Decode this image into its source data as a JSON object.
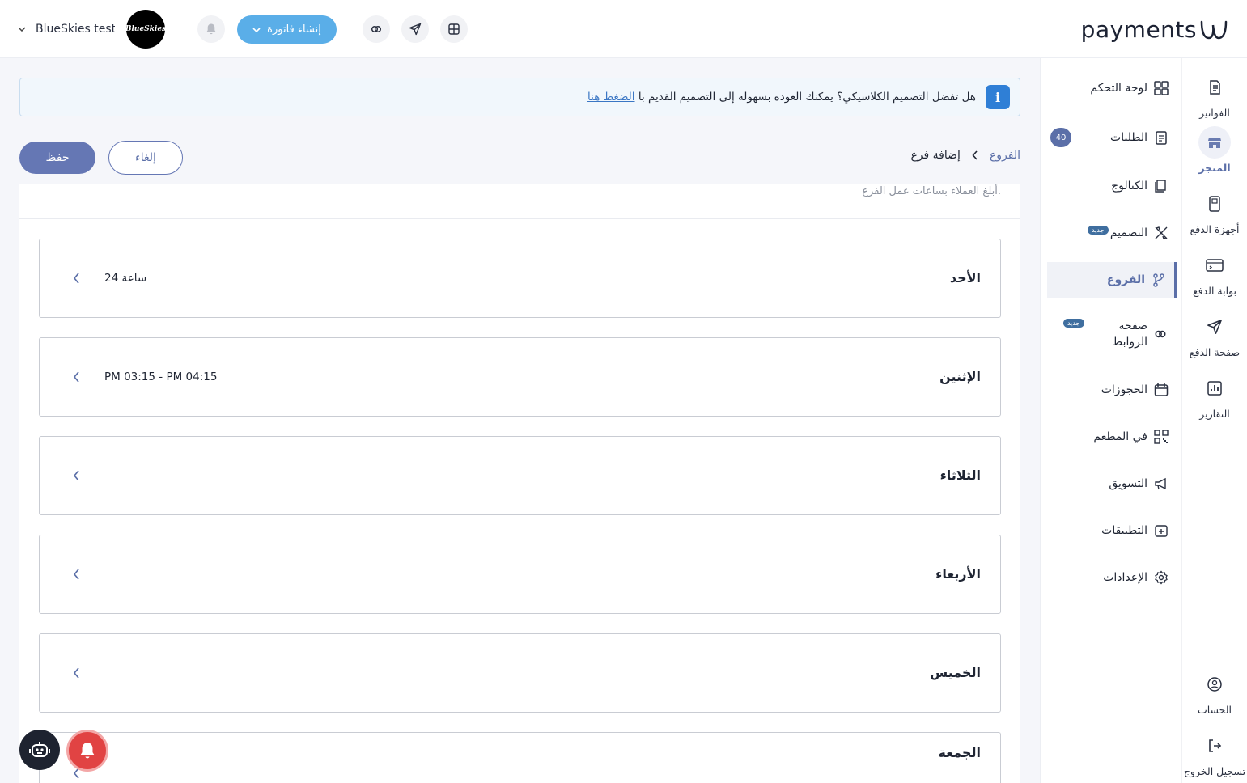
{
  "brand": {
    "name": "payments"
  },
  "header": {
    "user_name": "BlueSkies testi…",
    "avatar_text": "BlueSkies",
    "create_invoice_label": "إنشاء فاتورة"
  },
  "rail": {
    "items": [
      {
        "label": "الفواتير",
        "icon": "invoice-icon"
      },
      {
        "label": "المتجر",
        "icon": "store-icon",
        "active": true
      },
      {
        "label": "أجهزة الدفع",
        "icon": "pos-device-icon"
      },
      {
        "label": "بوابة الدفع",
        "icon": "gateway-icon"
      },
      {
        "label": "صفحة الدفع",
        "icon": "send-icon"
      },
      {
        "label": "التقارير",
        "icon": "reports-icon"
      }
    ],
    "account_label": "الحساب",
    "logout_label": "تسجيل الخروج"
  },
  "sidebar": {
    "items": [
      {
        "label": "لوحة التحكم",
        "icon": "dashboard-icon"
      },
      {
        "label": "الطلبات",
        "icon": "orders-icon",
        "badge": "40"
      },
      {
        "label": "الكتالوج",
        "icon": "catalog-icon"
      },
      {
        "label": "التصميم",
        "icon": "design-icon",
        "tag": "جديد"
      },
      {
        "label": "الفروع",
        "icon": "branches-icon",
        "active": true
      },
      {
        "label": "صفحة الروابط",
        "icon": "links-icon",
        "tag": "جديد"
      },
      {
        "label": "الحجوزات",
        "icon": "calendar-icon"
      },
      {
        "label": "في المطعم",
        "icon": "qr-icon"
      },
      {
        "label": "التسويق",
        "icon": "megaphone-icon"
      },
      {
        "label": "التطبيقات",
        "icon": "apps-icon"
      },
      {
        "label": "الإعدادات",
        "icon": "settings-icon"
      }
    ]
  },
  "banner": {
    "text": "هل تفضل التصميم الكلاسيكي؟ يمكنك العودة بسهولة إلى التصميم القديم با",
    "link": "الضغط هنا"
  },
  "breadcrumb": {
    "root": "الفروع",
    "current": "إضافة فرع"
  },
  "actions": {
    "save": "حفظ",
    "cancel": "إلغاء"
  },
  "card": {
    "subtitle": "أبلغ العملاء بساعات عمل الفرع.",
    "days": [
      {
        "name": "الأحد",
        "hours": "24 ساعة"
      },
      {
        "name": "الإثنين",
        "hours": "PM 03:15 - PM 04:15"
      },
      {
        "name": "الثلاثاء",
        "hours": ""
      },
      {
        "name": "الأربعاء",
        "hours": ""
      },
      {
        "name": "الخميس",
        "hours": ""
      },
      {
        "name": "الجمعة",
        "hours": ""
      }
    ]
  },
  "colors": {
    "accent": "#5b6fa8",
    "primary_button": "#6577b4",
    "invoice_button": "#5aaee8",
    "info": "#2f7fd6",
    "alert": "#e14343"
  }
}
